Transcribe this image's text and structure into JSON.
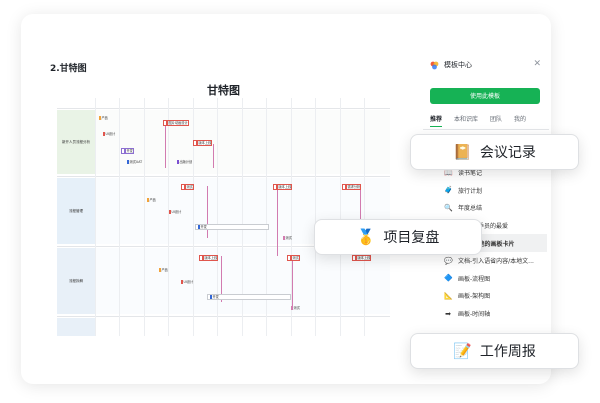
{
  "doc": {
    "section_title": "2.甘特图"
  },
  "gantt": {
    "title": "甘特图",
    "bands": [
      "新开人员流程分析",
      "流程管理",
      "流程拆解"
    ],
    "tasks": [
      {
        "label": "产品"
      },
      {
        "label": "UI设计"
      },
      {
        "label": "图片动画设计"
      },
      {
        "label": "开发"
      },
      {
        "label": "测试UAT"
      },
      {
        "label": "出版计划"
      },
      {
        "label": "版本上线"
      },
      {
        "label": "测试"
      },
      {
        "label": "版本上线"
      },
      {
        "label": "需求分析"
      },
      {
        "label": "产品"
      },
      {
        "label": "UI设计"
      },
      {
        "label": "开发"
      },
      {
        "label": "测试"
      },
      {
        "label": "版本上线"
      },
      {
        "label": "测试"
      },
      {
        "label": "版本上线"
      }
    ]
  },
  "panel": {
    "title": "模板中心",
    "use_button": "使用此模板",
    "tabs": [
      "推荐",
      "本和识库",
      "团队",
      "我的"
    ],
    "items": [
      {
        "label": "读书笔记",
        "icon": "book-icon"
      },
      {
        "label": "旅行计划",
        "icon": "travel-icon"
      },
      {
        "label": "年度总结",
        "icon": "search-icon"
      },
      {
        "label": "季员的最爱",
        "icon": "star-icon"
      },
      {
        "label": "文档-惊艳的画板卡片",
        "icon": "palette-icon"
      },
      {
        "label": "文档-引入语省内容/本地文...",
        "icon": "chat-icon"
      },
      {
        "label": "画板-流程图",
        "icon": "flow-icon"
      },
      {
        "label": "画板-架构图",
        "icon": "architecture-icon"
      },
      {
        "label": "画板-时间轴",
        "icon": "timeline-icon"
      }
    ]
  },
  "pills": [
    {
      "label": "会议记录",
      "icon": "notebook-icon"
    },
    {
      "label": "项目复盘",
      "icon": "medal-icon"
    },
    {
      "label": "工作周报",
      "icon": "memo-icon"
    }
  ]
}
